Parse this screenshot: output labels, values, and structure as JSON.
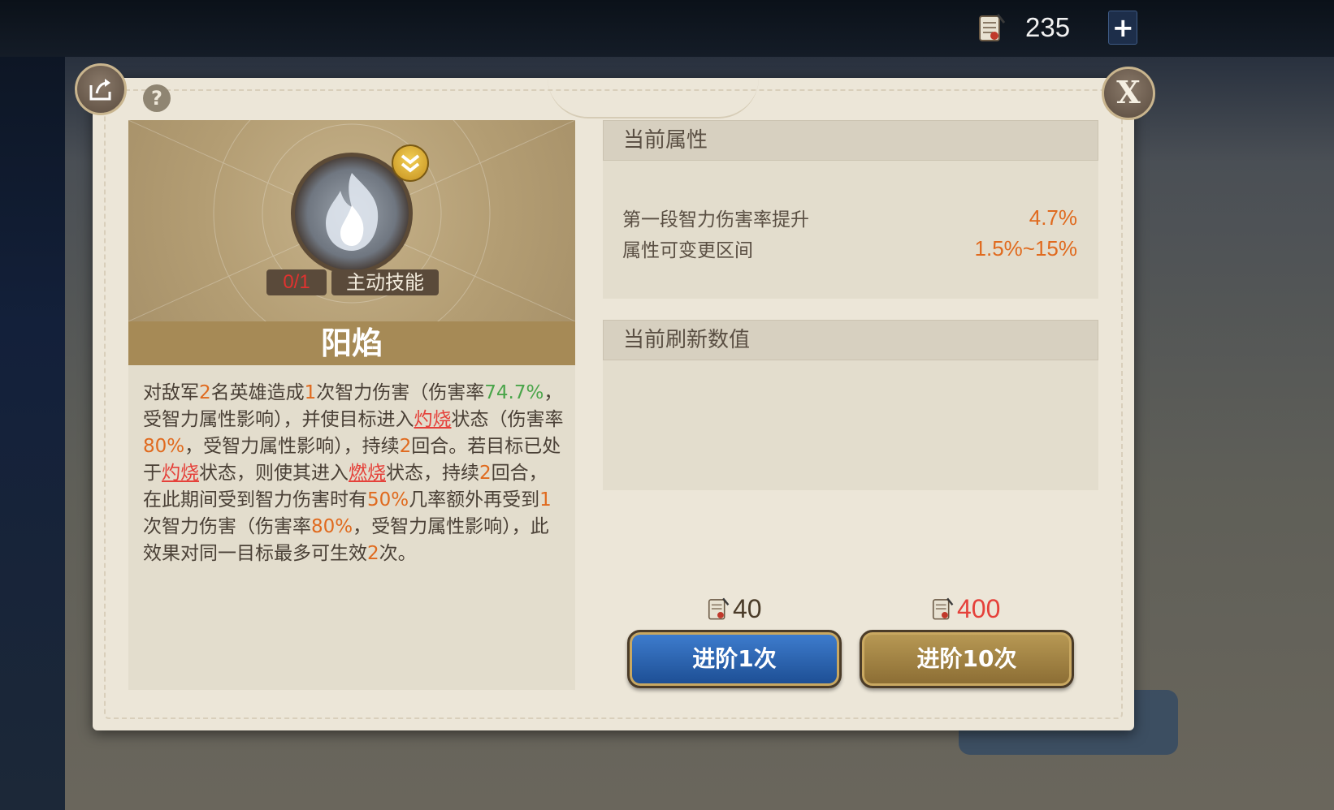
{
  "currency": {
    "amount": "235",
    "plus_label": "+"
  },
  "panel": {
    "close_label": "X",
    "help_label": "?"
  },
  "skill": {
    "count": "0/1",
    "type": "主动技能",
    "name": "阳焰",
    "description_segments": [
      {
        "t": "对敌军",
        "c": ""
      },
      {
        "t": "2",
        "c": "hl-orange"
      },
      {
        "t": "名英雄造成",
        "c": ""
      },
      {
        "t": "1",
        "c": "hl-orange"
      },
      {
        "t": "次智力伤害（伤害率",
        "c": ""
      },
      {
        "t": "74.7%",
        "c": "hl-green"
      },
      {
        "t": "，受智力属性影响），并使目标进入",
        "c": ""
      },
      {
        "t": "灼烧",
        "c": "hl-red"
      },
      {
        "t": "状态（伤害率",
        "c": ""
      },
      {
        "t": "80%",
        "c": "hl-orange"
      },
      {
        "t": "，受智力属性影响），持续",
        "c": ""
      },
      {
        "t": "2",
        "c": "hl-orange"
      },
      {
        "t": "回合。若目标已处于",
        "c": ""
      },
      {
        "t": "灼烧",
        "c": "hl-red"
      },
      {
        "t": "状态，则使其进入",
        "c": ""
      },
      {
        "t": "燃烧",
        "c": "hl-red"
      },
      {
        "t": "状态，持续",
        "c": ""
      },
      {
        "t": "2",
        "c": "hl-orange"
      },
      {
        "t": "回合，在此期间受到智力伤害时有",
        "c": ""
      },
      {
        "t": "50%",
        "c": "hl-orange"
      },
      {
        "t": "几率额外再受到",
        "c": ""
      },
      {
        "t": "1",
        "c": "hl-orange"
      },
      {
        "t": "次智力伤害（伤害率",
        "c": ""
      },
      {
        "t": "80%",
        "c": "hl-orange"
      },
      {
        "t": "，受智力属性影响），此效果对同一目标最多可生效",
        "c": ""
      },
      {
        "t": "2",
        "c": "hl-orange"
      },
      {
        "t": "次。",
        "c": ""
      }
    ]
  },
  "current_attributes": {
    "title": "当前属性",
    "rows": [
      {
        "label": "第一段智力伤害率提升",
        "value": "4.7%"
      },
      {
        "label": "属性可变更区间",
        "value": "1.5%~15%"
      }
    ]
  },
  "refresh": {
    "title": "当前刷新数值"
  },
  "advance": {
    "once": {
      "cost": "40",
      "label": "进阶1次",
      "cost_color": "#4a3b28"
    },
    "ten": {
      "cost": "400",
      "label": "进阶10次",
      "cost_color": "#e5413a"
    }
  }
}
